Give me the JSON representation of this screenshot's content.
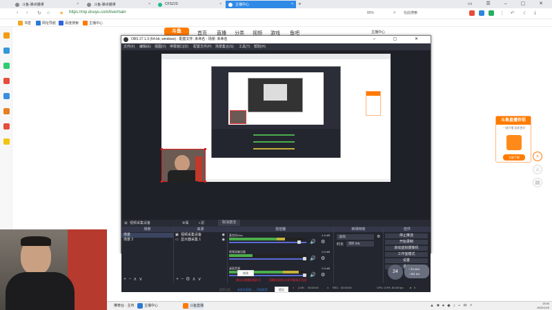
{
  "browser": {
    "tabs": [
      {
        "label": "斗鱼-弹点播课"
      },
      {
        "label": "斗鱼-弹点播课"
      },
      {
        "label": "CFSZJS"
      },
      {
        "label": "主播中心"
      }
    ],
    "active_tab": 3,
    "url": "https://mp.douyu.com/live/main",
    "zoom": "80%",
    "search_placeholder": "在此搜索",
    "bookmarks": [
      "书签",
      "网址导航",
      "百度搜索",
      "主播中心"
    ]
  },
  "site": {
    "logo": "斗鱼",
    "nav": [
      "首页",
      "直播",
      "分类",
      "视频",
      "游戏",
      "鱼吧"
    ],
    "user_label": "主播中心"
  },
  "obs": {
    "title": "OBS 27.1.3 (64-bit, windows) - 配置文件: 未命名 - 场景: 未命名",
    "menu": [
      "文件(F)",
      "编辑(E)",
      "视图(V)",
      "停靠窗口(D)",
      "配置文件(P)",
      "场景集合(S)",
      "工具(T)",
      "帮助(H)"
    ],
    "source_bar": {
      "no_source": "视频采集设备",
      "props": "属性",
      "filters": "滤镜",
      "deactivate": "取消激活"
    },
    "docks": {
      "scenes": {
        "header": "场景",
        "items": [
          "场景",
          "场景 2"
        ]
      },
      "sources": {
        "header": "来源",
        "items": [
          "视频采集设备",
          "显示器采集 1"
        ]
      },
      "mixer": {
        "header": "混音器",
        "channels": [
          {
            "name": "麦克风/Aux",
            "value": "-1.6 dB",
            "level": 0.72
          },
          {
            "name": "视频采集设备",
            "value": "0.0 dB",
            "level": 0.35
          },
          {
            "name": "桌面音频",
            "value": "0.0 dB",
            "level": 0.9
          }
        ]
      },
      "transitions": {
        "header": "转场特效",
        "type": "淡出",
        "duration_label": "时长",
        "duration": "300 ms"
      },
      "controls": {
        "header": "控件",
        "buttons": [
          "停止推流",
          "开始录制",
          "启动虚拟摄像机",
          "工作室模式",
          "设置",
          "退出"
        ]
      }
    },
    "status": {
      "live": "LIVE:",
      "live_time": "00:00:00",
      "rec": "REC:",
      "rec_time": "00:00:00",
      "cpu": "CPU: 0.9%, 60.00 fps",
      "dropped": "0"
    }
  },
  "page_content": {
    "button_label": "修改",
    "warning_red_1": "建议以直播封面形式",
    "warning_red_2": "直播间请到3分钟不要离开页面",
    "label_left": "推荐分类",
    "link_blue": "新版本直播——同城推荐",
    "button_label_2": "提交"
  },
  "promo": {
    "title": "斗鱼直播伴侣",
    "subtitle": "一键开播 画质更好",
    "button": "立即下载"
  },
  "timer": "24",
  "netspeed": {
    "up": "↑ 33.4k/s",
    "down": "↓ 381 b/s"
  },
  "taskbar": {
    "items": [
      "推荐台 - 主布",
      "主播中心",
      "斗鱼直播"
    ],
    "time": "13:00",
    "date": "2022/12/3"
  }
}
